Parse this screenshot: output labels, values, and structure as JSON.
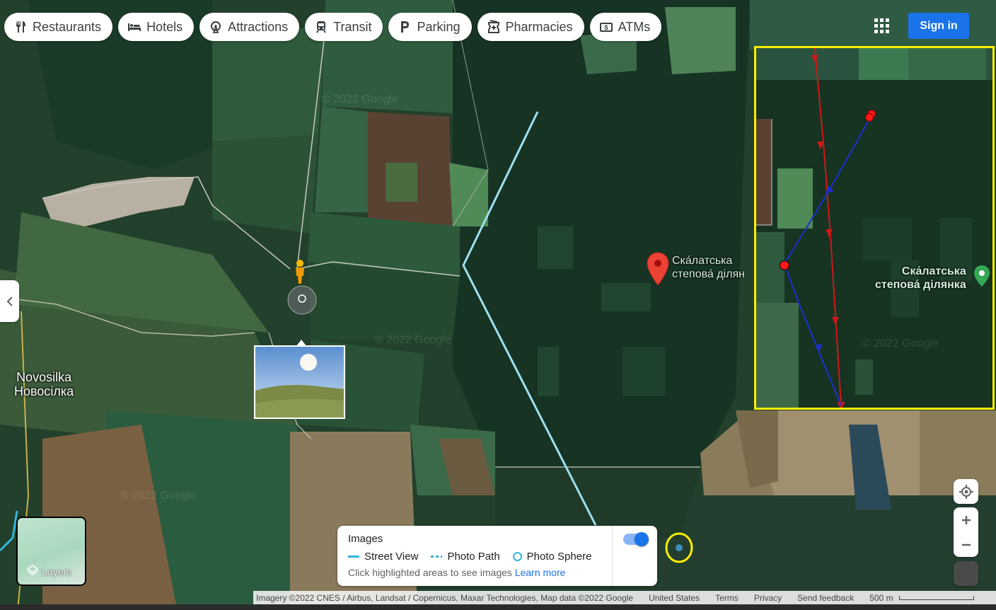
{
  "categories": [
    {
      "label": "Restaurants",
      "icon": "fork-knife-icon"
    },
    {
      "label": "Hotels",
      "icon": "bed-icon"
    },
    {
      "label": "Attractions",
      "icon": "ferris-wheel-icon"
    },
    {
      "label": "Transit",
      "icon": "train-icon"
    },
    {
      "label": "Parking",
      "icon": "parking-icon"
    },
    {
      "label": "Pharmacies",
      "icon": "pharmacy-icon"
    },
    {
      "label": "ATMs",
      "icon": "atm-icon"
    }
  ],
  "header": {
    "sign_in": "Sign in",
    "apps_icon": "apps-grid-icon"
  },
  "places": {
    "village_latin": "Novosilka",
    "village_cyrillic": "Новосілка",
    "poi_main_line1": "Ска́латська",
    "poi_main_line2": "степова́ ділян",
    "poi_inset_line1": "Ска́латська",
    "poi_inset_line2": "степова́ ділянка"
  },
  "layers": {
    "label": "Layers"
  },
  "images_panel": {
    "title": "Images",
    "legend": [
      "Street View",
      "Photo Path",
      "Photo Sphere"
    ],
    "hint": "Click highlighted areas to see images",
    "learn_more": "Learn more",
    "toggle_on": true
  },
  "footer": {
    "attribution": "Imagery ©2022 CNES / Airbus, Landsat / Copernicus, Maxar Technologies, Map data ©2022 Google",
    "region": "United States",
    "terms": "Terms",
    "privacy": "Privacy",
    "feedback": "Send feedback",
    "scale": "500 m"
  },
  "watermark": "© 2022 Google",
  "colors": {
    "primary_blue": "#1a73e8",
    "street_view_line": "#9fe0f0",
    "annotation_yellow": "#ffee00",
    "annotation_red": "#d01818",
    "annotation_blue": "#1e2fd0",
    "pin_red": "#ea4335"
  }
}
